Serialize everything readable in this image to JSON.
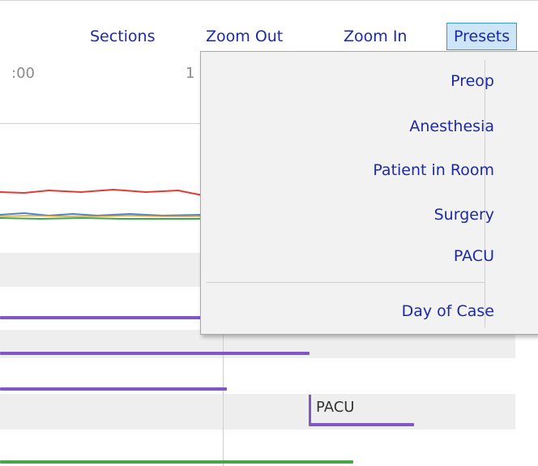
{
  "toolbar": {
    "sections_label": "Sections",
    "zoom_out_label": "Zoom Out",
    "zoom_in_label": "Zoom In",
    "presets_label": "Presets"
  },
  "timeline": {
    "tick_label_1": ":00",
    "tick_label_2": "1",
    "bar_label_pacu": "PACU"
  },
  "presets_menu": {
    "items": [
      "Preop",
      "Anesthesia",
      "Patient in Room",
      "Surgery",
      "PACU"
    ],
    "day_of_case_label": "Day of Case"
  },
  "colors": {
    "link": "#1c2aa8",
    "presets_selected_bg": "#cde6f7",
    "presets_selected_border": "#3a96dd",
    "line_red": "#e53935",
    "line_blue": "#4a84c6",
    "line_green": "#3fa84a",
    "bar_purple": "#7f57c8",
    "bar_green": "#4aa54a"
  }
}
